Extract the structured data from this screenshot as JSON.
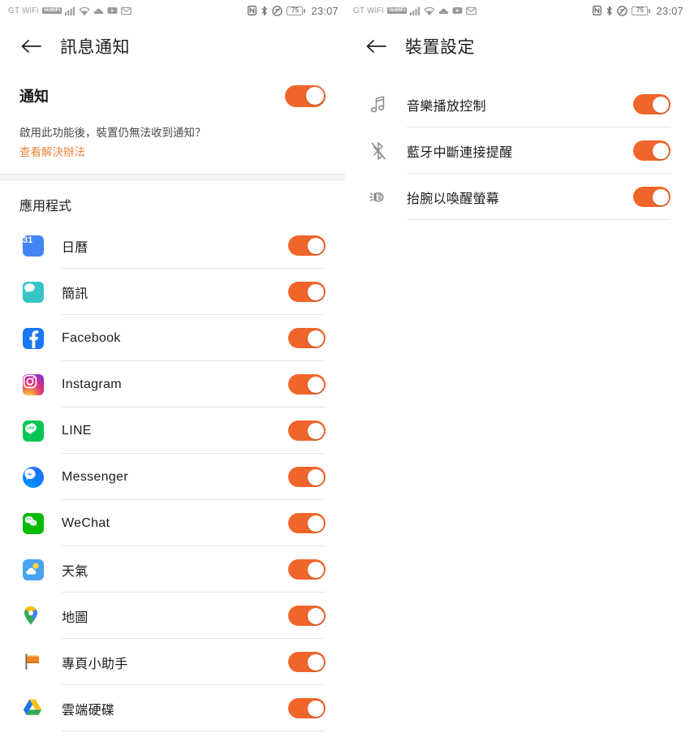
{
  "statusbar": {
    "carrier": "GT WiFi",
    "vowifi_badge": "VoWiFi",
    "battery_level": "75",
    "time": "23:07",
    "icons": [
      "signal-icon",
      "wifi-icon",
      "cloud-icon",
      "youtube-icon",
      "gmail-icon",
      "nfc-icon",
      "bluetooth-icon",
      "dnd-icon",
      "battery-icon"
    ]
  },
  "left_screen": {
    "title": "訊息通知",
    "back_label": "←",
    "notification": {
      "label": "通知",
      "toggle_on": true,
      "description": "啟用此功能後，裝置仍無法收到通知？",
      "link": "查看解決辦法"
    },
    "apps_section_header": "應用程式",
    "apps": [
      {
        "label": "日曆",
        "icon": "calendar-icon",
        "icon_text": "31",
        "toggle_on": true
      },
      {
        "label": "簡訊",
        "icon": "messages-icon",
        "icon_text": "",
        "toggle_on": true
      },
      {
        "label": "Facebook",
        "icon": "facebook-icon",
        "icon_text": "f",
        "toggle_on": true
      },
      {
        "label": "Instagram",
        "icon": "instagram-icon",
        "icon_text": "",
        "toggle_on": true
      },
      {
        "label": "LINE",
        "icon": "line-icon",
        "icon_text": "LINE",
        "toggle_on": true
      },
      {
        "label": "Messenger",
        "icon": "messenger-icon",
        "icon_text": "",
        "toggle_on": true
      },
      {
        "label": "WeChat",
        "icon": "wechat-icon",
        "icon_text": "",
        "toggle_on": true
      },
      {
        "label": "天氣",
        "icon": "weather-icon",
        "icon_text": "",
        "toggle_on": true
      },
      {
        "label": "地圖",
        "icon": "maps-icon",
        "icon_text": "",
        "toggle_on": true
      },
      {
        "label": "專頁小助手",
        "icon": "pages-manager-icon",
        "icon_text": "",
        "toggle_on": true
      },
      {
        "label": "雲端硬碟",
        "icon": "google-drive-icon",
        "icon_text": "",
        "toggle_on": true
      }
    ]
  },
  "right_screen": {
    "title": "裝置設定",
    "back_label": "←",
    "settings": [
      {
        "label": "音樂播放控制",
        "icon": "music-note-icon",
        "toggle_on": true
      },
      {
        "label": "藍牙中斷連接提醒",
        "icon": "bluetooth-off-icon",
        "toggle_on": true
      },
      {
        "label": "抬腕以喚醒螢幕",
        "icon": "raise-wrist-icon",
        "toggle_on": true
      }
    ]
  },
  "colors": {
    "toggle_on": "#f06529",
    "link": "#e8883f",
    "divider": "#e6e6e6",
    "text_primary": "#1c1c1c"
  }
}
